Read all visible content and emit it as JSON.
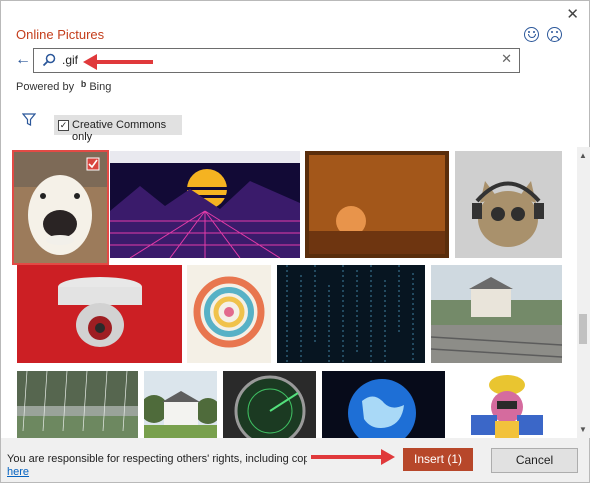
{
  "dialog": {
    "title": "Online Pictures",
    "close_label": "✕"
  },
  "search": {
    "query": ".gif",
    "clear_label": "✕"
  },
  "powered_by": {
    "label": "Powered by",
    "brand": "Bing"
  },
  "filter": {
    "creative_commons_label": "Creative Commons only",
    "creative_commons_checked": true,
    "check_mark": "✓"
  },
  "results": {
    "selected_count": 1,
    "thumbnails": [
      {
        "name": "smiling-dog",
        "selected": true
      },
      {
        "name": "retro-sunset-grid",
        "selected": false
      },
      {
        "name": "orange-moon-dusk",
        "selected": false
      },
      {
        "name": "cat-headphones",
        "selected": false
      },
      {
        "name": "security-camera-red",
        "selected": false
      },
      {
        "name": "spiral-infographic",
        "selected": false
      },
      {
        "name": "matrix-code",
        "selected": false
      },
      {
        "name": "train-station",
        "selected": false
      },
      {
        "name": "rainy-forest",
        "selected": false
      },
      {
        "name": "white-house-trees",
        "selected": false
      },
      {
        "name": "radar-screen",
        "selected": false
      },
      {
        "name": "blue-globe",
        "selected": false
      },
      {
        "name": "cartoon-robot",
        "selected": false
      }
    ]
  },
  "footer": {
    "notice": "You are responsible for respecting others' rights, including copyright.",
    "link": "here",
    "insert_label": "Insert (1)",
    "cancel_label": "Cancel"
  },
  "colors": {
    "accent": "#c43e1c",
    "primary_button": "#b7472a",
    "annotation_arrow": "#e0393b"
  }
}
